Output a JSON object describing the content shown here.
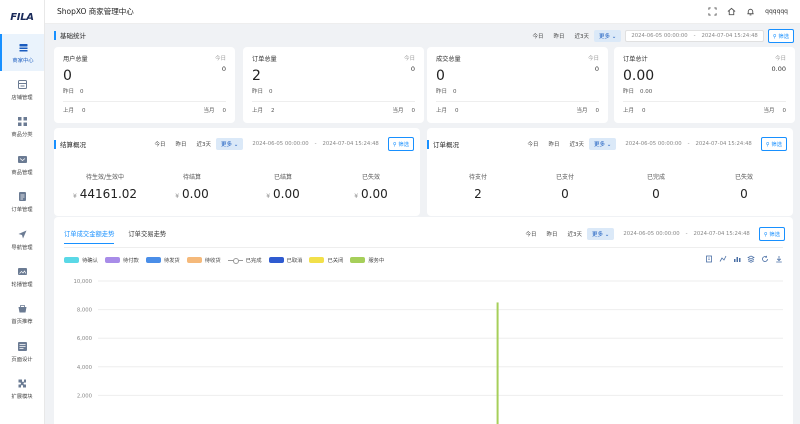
{
  "app": {
    "logo": "FILA",
    "title": "ShopXO 商家管理中心",
    "user": "qqqqqq"
  },
  "sidebar": {
    "items": [
      {
        "label": "商家中心",
        "icon": "store-icon",
        "active": true
      },
      {
        "label": "店铺管理",
        "icon": "shop-icon"
      },
      {
        "label": "商品分类",
        "icon": "category-icon"
      },
      {
        "label": "商品管理",
        "icon": "goods-icon"
      },
      {
        "label": "订单管理",
        "icon": "order-icon"
      },
      {
        "label": "导航管理",
        "icon": "navigation-icon"
      },
      {
        "label": "轮播管理",
        "icon": "carousel-icon"
      },
      {
        "label": "首页推荐",
        "icon": "recommend-icon"
      },
      {
        "label": "页面设计",
        "icon": "page-design-icon"
      },
      {
        "label": "扩展模块",
        "icon": "extension-icon"
      }
    ]
  },
  "filters": {
    "today": "今日",
    "yesterday": "昨日",
    "last3": "近3天",
    "more": "更多",
    "start_date": "2024-06-05 00:00:00",
    "end_date": "2024-07-04 15:24:48",
    "dash": "-",
    "apply": "筛选"
  },
  "basic_stats": {
    "title": "基础统计",
    "cards": [
      {
        "label": "用户总量",
        "tag": "今日",
        "total": "0",
        "today": "0",
        "yesterday_label": "昨日",
        "yesterday": "0",
        "last_month_label": "上月",
        "last_month": "0",
        "this_month_label": "当月",
        "this_month": "0"
      },
      {
        "label": "订单总量",
        "tag": "今日",
        "total": "2",
        "today": "0",
        "yesterday_label": "昨日",
        "yesterday": "0",
        "last_month_label": "上月",
        "last_month": "2",
        "this_month_label": "当月",
        "this_month": "0"
      },
      {
        "label": "成交总量",
        "tag": "今日",
        "total": "0",
        "today": "0",
        "yesterday_label": "昨日",
        "yesterday": "0",
        "last_month_label": "上月",
        "last_month": "0",
        "this_month_label": "当月",
        "this_month": "0"
      },
      {
        "label": "订单总计",
        "tag": "今日",
        "total": "0.00",
        "today": "0.00",
        "yesterday_label": "昨日",
        "yesterday": "0.00",
        "last_month_label": "上月",
        "last_month": "0",
        "this_month_label": "当月",
        "this_month": "0"
      }
    ]
  },
  "settlement": {
    "title": "结算概况",
    "currency": "¥",
    "cols": [
      {
        "label": "待生效/生效中",
        "value": "44161.02"
      },
      {
        "label": "待结算",
        "value": "0.00"
      },
      {
        "label": "已结算",
        "value": "0.00"
      },
      {
        "label": "已失效",
        "value": "0.00"
      }
    ]
  },
  "order_overview": {
    "title": "订单概况",
    "cols": [
      {
        "label": "待支付",
        "value": "2"
      },
      {
        "label": "已支付",
        "value": "0"
      },
      {
        "label": "已完成",
        "value": "0"
      },
      {
        "label": "已失效",
        "value": "0"
      }
    ]
  },
  "trend": {
    "tabs": [
      "订单成交金额走势",
      "订单交易走势"
    ],
    "legend": [
      {
        "name": "待确认",
        "color": "#5ad8e6"
      },
      {
        "name": "待付款",
        "color": "#a88ce8"
      },
      {
        "name": "待发货",
        "color": "#4a8ee8"
      },
      {
        "name": "待收货",
        "color": "#f5b97a"
      },
      {
        "name": "已完成",
        "color": "#999999",
        "line": true
      },
      {
        "name": "已取消",
        "color": "#2f5bd0"
      },
      {
        "name": "已关闭",
        "color": "#f2e04a"
      },
      {
        "name": "服务中",
        "color": "#a6cf5a"
      }
    ],
    "toolbox": [
      "data-view-icon",
      "line-switch-icon",
      "bar-switch-icon",
      "stack-icon",
      "restore-icon",
      "download-icon"
    ]
  },
  "chart_data": {
    "type": "bar",
    "title": "",
    "xlabel": "",
    "ylabel": "",
    "ylim": [
      0,
      10000
    ],
    "yticks": [
      "10,000",
      "8,000",
      "6,000",
      "4,000",
      "2,000"
    ],
    "categories_count": 30,
    "series": [
      {
        "name": "服务中",
        "color": "#a6cf5a",
        "spike_index": 17,
        "spike_value": 8500
      }
    ]
  }
}
